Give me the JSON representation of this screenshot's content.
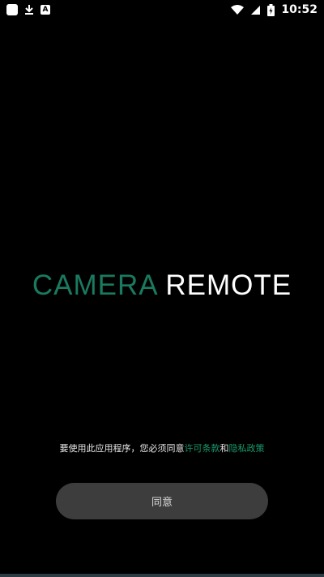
{
  "status": {
    "time": "10:52",
    "icons": [
      "notification-square-icon",
      "download-icon",
      "a-icon",
      "wifi-icon",
      "signal-icon",
      "battery-charging-icon"
    ]
  },
  "logo": {
    "part1": "CAMERA",
    "part2": " REMOTE"
  },
  "consent": {
    "prefix": "要使用此应用程序，您必须同意",
    "license_link": "许可条款",
    "and": "和",
    "privacy_link": "隐私政策"
  },
  "agree_button": {
    "label": "同意"
  },
  "colors": {
    "accent": "#197a5f",
    "link": "#1a9a6b",
    "button_bg": "#3d3d3d"
  }
}
